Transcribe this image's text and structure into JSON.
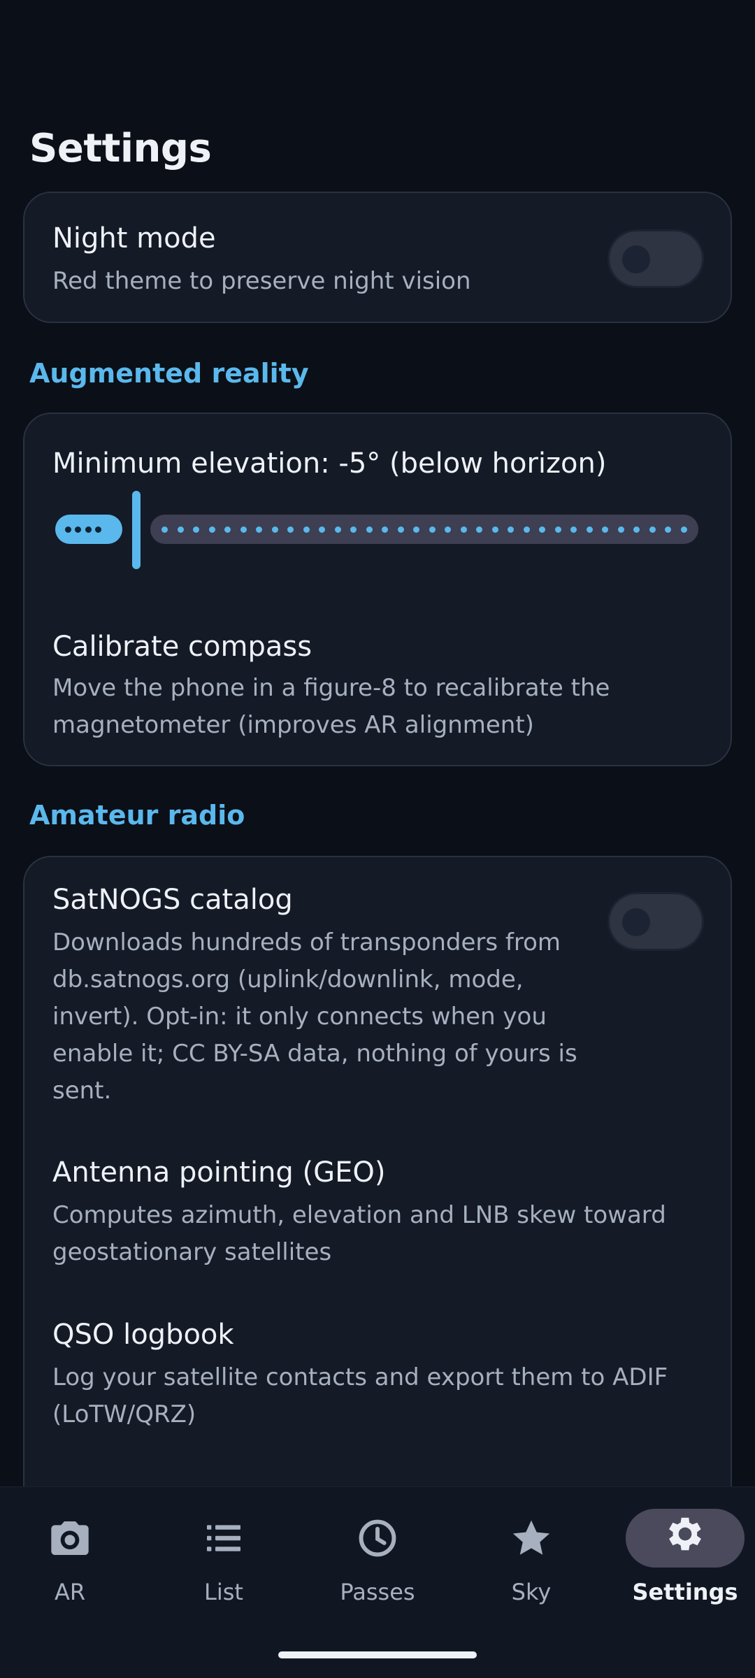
{
  "page": {
    "title": "Settings"
  },
  "night_mode": {
    "title": "Night mode",
    "subtitle": "Red theme to preserve night vision",
    "enabled": false
  },
  "ar_section": {
    "header": "Augmented reality",
    "min_elevation": {
      "label": "Minimum elevation: -5° (below horizon)",
      "value_deg": -5
    },
    "calibrate": {
      "title": "Calibrate compass",
      "subtitle_line1": "Move the phone in a figure-8 to recalibrate the",
      "subtitle_line2": "magnetometer (improves AR alignment)"
    }
  },
  "radio_section": {
    "header": "Amateur radio",
    "satnogs": {
      "title": "SatNOGS catalog",
      "lines": [
        "Downloads hundreds of transponders from",
        "db.satnogs.org (uplink/downlink, mode,",
        "invert). Opt-in: it only connects when you",
        "enable it; CC BY-SA data, nothing of yours is",
        "sent."
      ],
      "enabled": false
    },
    "antenna": {
      "title": "Antenna pointing (GEO)",
      "lines": [
        "Computes azimuth, elevation and LNB skew toward",
        "geostationary satellites"
      ]
    },
    "qso": {
      "title": "QSO logbook",
      "lines": [
        "Log your satellite contacts and export them to ADIF",
        "(LoTW/QRZ)"
      ]
    }
  },
  "nav": {
    "items": [
      {
        "label": "AR",
        "icon": "camera-icon"
      },
      {
        "label": "List",
        "icon": "list-icon"
      },
      {
        "label": "Passes",
        "icon": "clock-icon"
      },
      {
        "label": "Sky",
        "icon": "star-icon"
      },
      {
        "label": "Settings",
        "icon": "gear-icon"
      }
    ],
    "active": "Settings"
  },
  "colors": {
    "accent": "#5ab8ec",
    "background": "#0b0f17",
    "card": "#141a26"
  }
}
